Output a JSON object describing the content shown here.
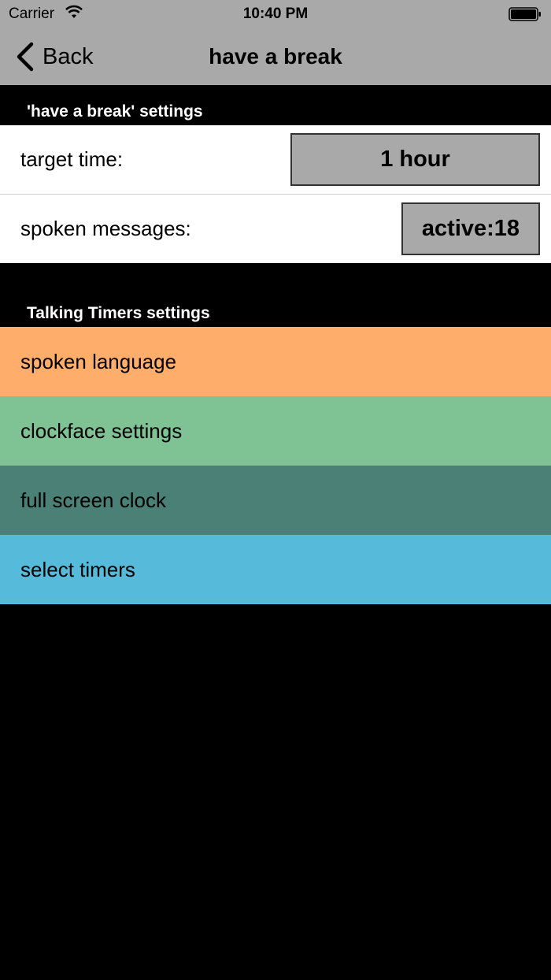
{
  "status_bar": {
    "carrier": "Carrier",
    "time": "10:40 PM"
  },
  "nav": {
    "back_label": "Back",
    "title": "have a break"
  },
  "timer_settings": {
    "header": "'have a break' settings",
    "target_time_label": "target time:",
    "target_time_value": "1 hour",
    "spoken_messages_label": "spoken messages:",
    "spoken_messages_value": "active:18"
  },
  "app_settings": {
    "header": "Talking Timers settings",
    "items": [
      {
        "label": "spoken language",
        "color": "#ffad6b"
      },
      {
        "label": "clockface settings",
        "color": "#7fc294"
      },
      {
        "label": "full screen clock",
        "color": "#4a8076"
      },
      {
        "label": "select timers",
        "color": "#56bbdb"
      }
    ]
  },
  "colors": {
    "bar_gray": "#a9a9a9",
    "background": "#000000"
  }
}
